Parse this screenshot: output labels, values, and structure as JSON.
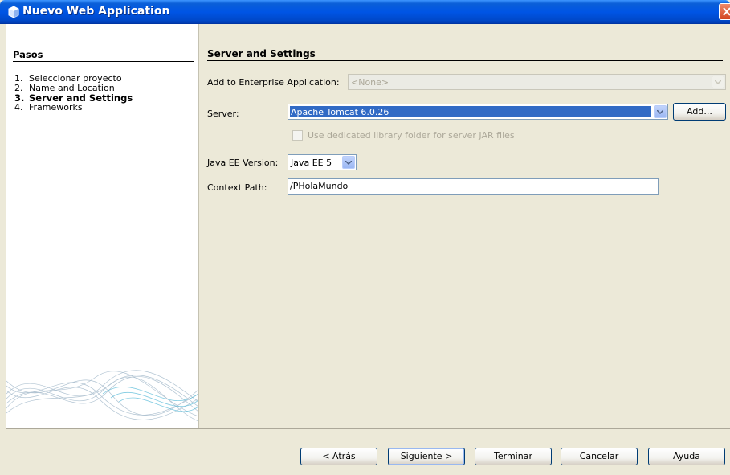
{
  "window": {
    "title": "Nuevo  Web Application"
  },
  "steps_panel": {
    "title": "Pasos",
    "steps": [
      {
        "num": "1.",
        "label": "Seleccionar proyecto"
      },
      {
        "num": "2.",
        "label": "Name and Location"
      },
      {
        "num": "3.",
        "label": "Server and Settings"
      },
      {
        "num": "4.",
        "label": "Frameworks"
      }
    ]
  },
  "settings": {
    "title": "Server and Settings",
    "enterprise_label": "Add to Enterprise Application:",
    "enterprise_value": "<None>",
    "server_label": "Server:",
    "server_value": "Apache Tomcat 6.0.26",
    "add_button": "Add...",
    "dedicated_checkbox_label": "Use dedicated library folder for server JAR files",
    "javaee_label": "Java EE Version:",
    "javaee_value": "Java EE 5",
    "context_label": "Context Path:",
    "context_value": "/PHolaMundo"
  },
  "buttons": {
    "back": "< Atrás",
    "next": "Siguiente >",
    "finish": "Terminar",
    "cancel": "Cancelar",
    "help": "Ayuda"
  },
  "colors": {
    "titlebar": "#0055e5",
    "selection": "#316ac5",
    "dialog_bg": "#ece9d8"
  }
}
